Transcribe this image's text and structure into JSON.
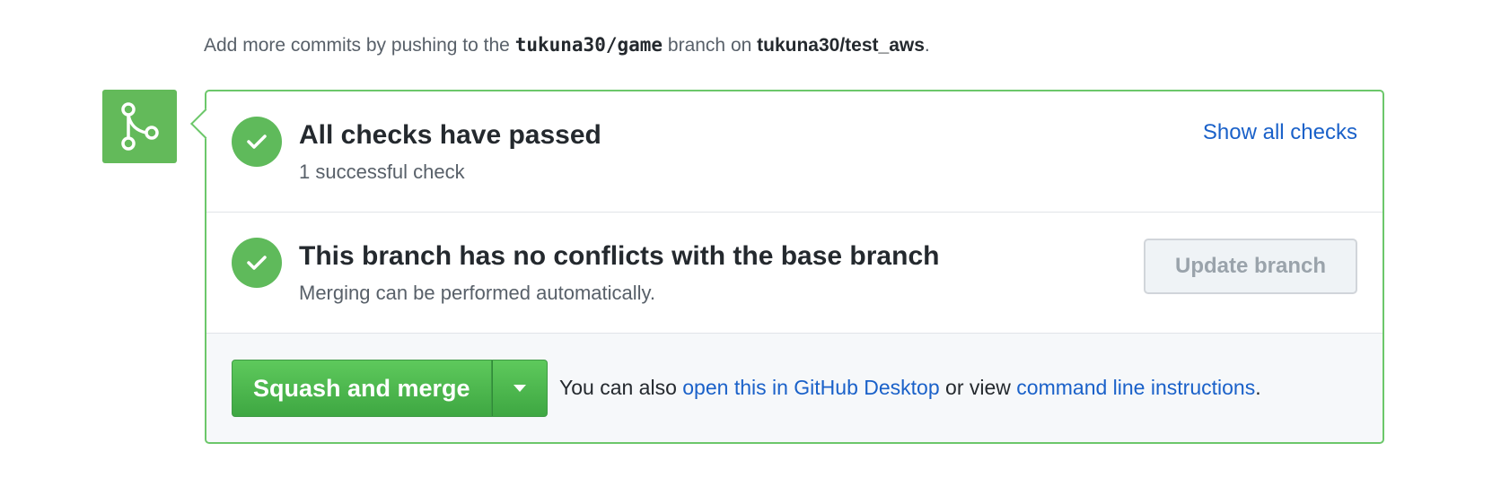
{
  "hint": {
    "prefix": "Add more commits by pushing to the",
    "branch": "tukuna30/game",
    "middle": "branch on",
    "repo": "tukuna30/test_aws",
    "suffix": "."
  },
  "icons": {
    "merge": "git-merge-icon",
    "check": "check-icon",
    "caret": "chevron-down-icon"
  },
  "colors": {
    "success": "#5fba5b",
    "border": "#6cc76a",
    "link": "#1a61c9"
  },
  "checks": {
    "title": "All checks have passed",
    "subtitle": "1 successful check",
    "show_all_label": "Show all checks"
  },
  "conflicts": {
    "title": "This branch has no conflicts with the base branch",
    "subtitle": "Merging can be performed automatically.",
    "update_label": "Update branch"
  },
  "merge": {
    "button_label": "Squash and merge",
    "also_prefix": "You can also",
    "desktop_link": "open this in GitHub Desktop",
    "or_view": "or view",
    "cli_link": "command line instructions",
    "suffix": "."
  }
}
